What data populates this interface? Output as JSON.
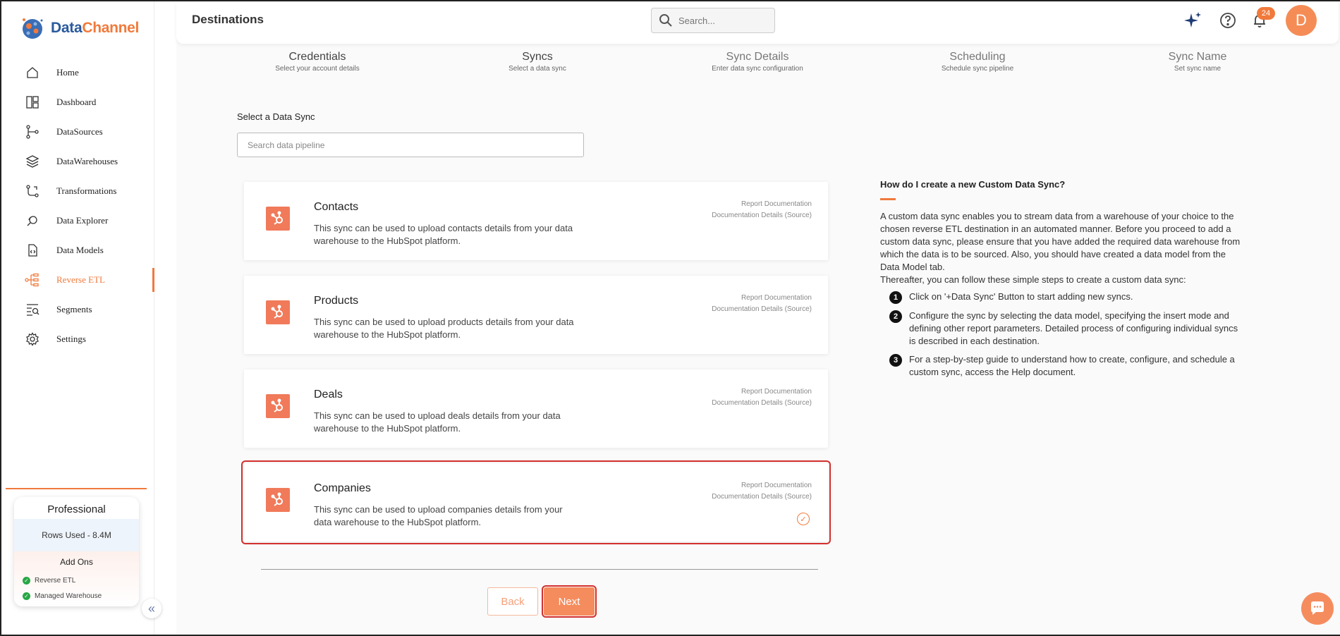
{
  "brand": {
    "part1": "Data",
    "part2": "Channel"
  },
  "sidebar": {
    "items": [
      {
        "label": "Home",
        "icon": "home-icon"
      },
      {
        "label": "Dashboard",
        "icon": "dashboard-icon"
      },
      {
        "label": "DataSources",
        "icon": "datasources-icon"
      },
      {
        "label": "DataWarehouses",
        "icon": "layers-icon"
      },
      {
        "label": "Transformations",
        "icon": "transformations-icon"
      },
      {
        "label": "Data Explorer",
        "icon": "explorer-icon"
      },
      {
        "label": "Data Models",
        "icon": "data-models-icon"
      },
      {
        "label": "Reverse ETL",
        "icon": "reverse-etl-icon",
        "active": true
      },
      {
        "label": "Segments",
        "icon": "segments-icon"
      },
      {
        "label": "Settings",
        "icon": "gear-icon"
      }
    ],
    "plan": {
      "title": "Professional",
      "rows_used": "Rows Used - 8.4M",
      "addons_title": "Add Ons",
      "addons": [
        "Reverse ETL",
        "Managed Warehouse"
      ]
    }
  },
  "header": {
    "title": "Destinations",
    "search_placeholder": "Search...",
    "notification_count": "24",
    "avatar_initial": "D"
  },
  "steps": [
    {
      "title": "Credentials",
      "desc": "Select your account details"
    },
    {
      "title": "Syncs",
      "desc": "Select a data sync"
    },
    {
      "title": "Sync Details",
      "desc": "Enter data sync configuration"
    },
    {
      "title": "Scheduling",
      "desc": "Schedule sync pipeline"
    },
    {
      "title": "Sync Name",
      "desc": "Set sync name"
    }
  ],
  "main": {
    "select_label": "Select a Data Sync",
    "search_placeholder": "Search data pipeline",
    "report_link": "Report Documentation",
    "doc_link": "Documentation Details (Source)",
    "syncs": [
      {
        "name": "Contacts",
        "desc": "This sync can be used to upload contacts details from your data warehouse to the HubSpot platform."
      },
      {
        "name": "Products",
        "desc": "This sync can be used to upload products details from your data warehouse to the HubSpot platform."
      },
      {
        "name": "Deals",
        "desc": "This sync can be used to upload deals details from your data warehouse to the HubSpot platform."
      },
      {
        "name": "Companies",
        "desc": "This sync can be used to upload companies details from your data warehouse to the HubSpot platform.",
        "selected": true
      }
    ],
    "back_label": "Back",
    "next_label": "Next"
  },
  "help": {
    "title": "How do I create a new Custom Data Sync?",
    "body1": "A custom data sync enables you to stream data from a warehouse of your choice to the chosen reverse ETL destination in an automated manner. Before you proceed to add a custom data sync, please ensure that you have added the required data warehouse from which the data is to be sourced. Also, you should have created a data model from the Data Model tab.",
    "body2": "Thereafter, you can follow these simple steps to create a custom data sync:",
    "steps": [
      {
        "num": "1",
        "text": "Click on '+Data Sync' Button to start adding new syncs."
      },
      {
        "num": "2",
        "text": "Configure the sync by selecting the data model, specifying the insert mode and defining other report parameters. Detailed process of configuring individual syncs is described in each destination."
      },
      {
        "num": "3",
        "text": "For a step-by-step guide to understand how to create, configure, and schedule a custom sync, access the Help document."
      }
    ]
  },
  "colors": {
    "accent": "#f07a3c",
    "brand_blue": "#2a5a9e",
    "selected_outline": "#d32f2f"
  }
}
